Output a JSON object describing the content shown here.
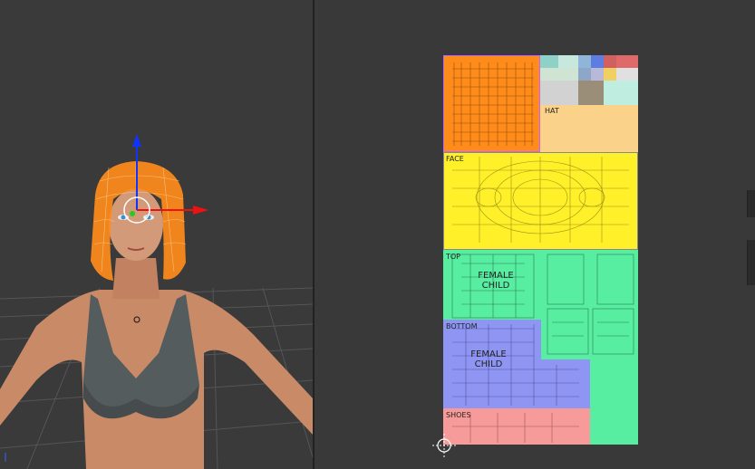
{
  "viewport3d": {
    "name": "3D Viewport"
  },
  "uv": {
    "hat_label": "HAT",
    "face_label": "FACE",
    "top_label": "TOP",
    "top_group": "FEMALE\nCHILD",
    "bottom_label": "BOTTOM",
    "bottom_group": "FEMALE\nCHILD",
    "shoes_label": "SHOES"
  },
  "colors": {
    "hair": "#ff8c1a",
    "hat": "#fbd28a",
    "face": "#fff02a",
    "top": "#57eea2",
    "bottom": "#8f95f3",
    "shoes": "#f69a9a",
    "gizmo_z": "#1133ff",
    "gizmo_x": "#ee1111"
  }
}
